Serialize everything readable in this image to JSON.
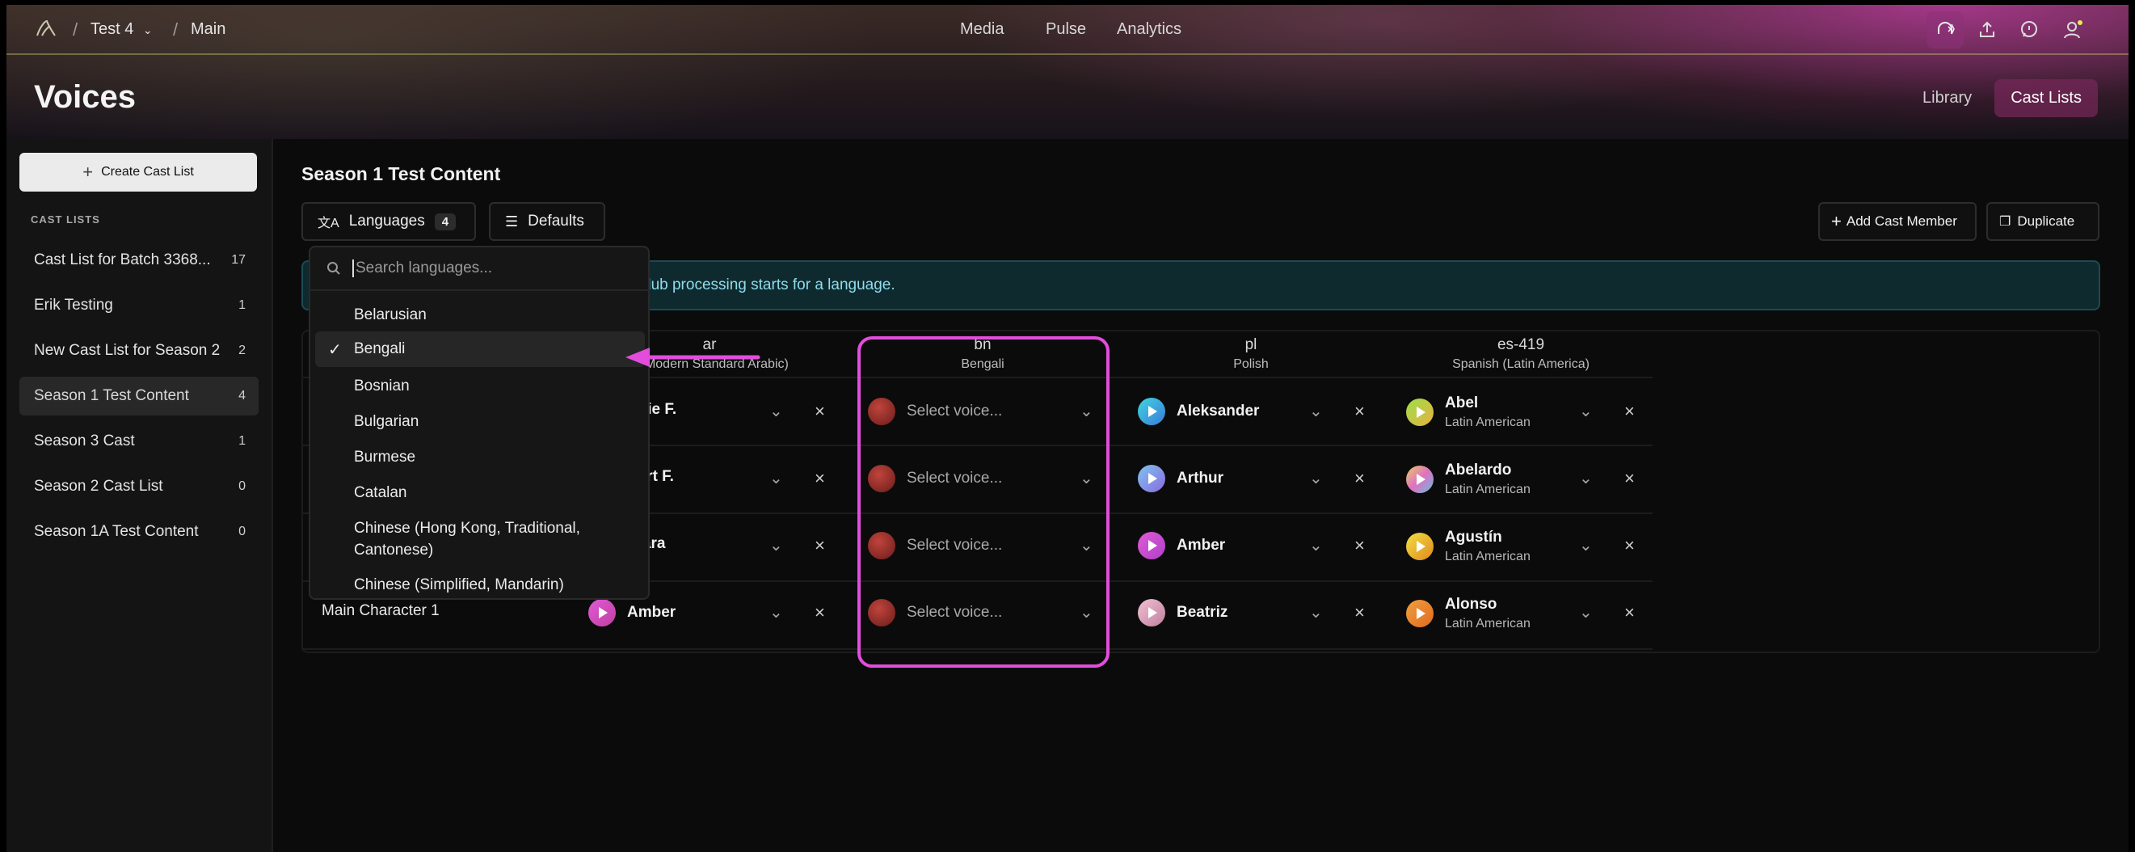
{
  "header": {
    "project": "Test 4",
    "branch": "Main",
    "nav": [
      "Media",
      "Pulse",
      "Analytics"
    ],
    "page_title": "Voices",
    "tabs": [
      {
        "label": "Library",
        "active": false
      },
      {
        "label": "Cast Lists",
        "active": true
      }
    ]
  },
  "sidebar": {
    "create_label": "Create Cast List",
    "section_label": "CAST LISTS",
    "items": [
      {
        "label": "Cast List for Batch 3368...",
        "count": "17",
        "active": false
      },
      {
        "label": "Erik Testing",
        "count": "1",
        "active": false
      },
      {
        "label": "New Cast List for Season 2",
        "count": "2",
        "active": false
      },
      {
        "label": "Season 1 Test Content",
        "count": "4",
        "active": true
      },
      {
        "label": "Season 3 Cast",
        "count": "1",
        "active": false
      },
      {
        "label": "Season 2 Cast List",
        "count": "0",
        "active": false
      },
      {
        "label": "Season 1A Test Content",
        "count": "0",
        "active": false
      }
    ]
  },
  "main": {
    "title": "Season 1 Test Content",
    "languages_label": "Languages",
    "languages_count": "4",
    "defaults_label": "Defaults",
    "add_member_label": "Add Cast Member",
    "duplicate_label": "Duplicate",
    "info_text": "dub processing starts for a language.",
    "columns": [
      {
        "code": "ar",
        "name": "c (Modern Standard Arabic)"
      },
      {
        "code": "bn",
        "name": "Bengali"
      },
      {
        "code": "pl",
        "name": "Polish"
      },
      {
        "code": "es-419",
        "name": "Spanish (Latin America)"
      }
    ],
    "rows": [
      {
        "character": "",
        "ar": "bbie F.",
        "bn": "Select voice...",
        "pl": "Aleksander",
        "es": "Abel",
        "es_sub": "Latin American"
      },
      {
        "character": "",
        "ar": "bert F.",
        "bn": "Select voice...",
        "pl": "Arthur",
        "es": "Abelardo",
        "es_sub": "Latin American"
      },
      {
        "character": "",
        "ar": "mara",
        "bn": "Select voice...",
        "pl": "Amber",
        "es": "Agustín",
        "es_sub": "Latin American"
      },
      {
        "character": "Main Character 1",
        "ar": "Amber",
        "bn": "Select voice...",
        "pl": "Beatriz",
        "es": "Alonso",
        "es_sub": "Latin American"
      }
    ]
  },
  "dropdown": {
    "search_placeholder": "Search languages...",
    "selected": "Bengali",
    "items": [
      "Belarusian",
      "Bengali",
      "Bosnian",
      "Bulgarian",
      "Burmese",
      "Catalan",
      "Chinese (Hong Kong, Traditional, Cantonese)",
      "Chinese (Simplified, Mandarin)"
    ]
  },
  "colors": {
    "accent_pink": "#e34ddc",
    "info_text": "#8fdcec"
  }
}
